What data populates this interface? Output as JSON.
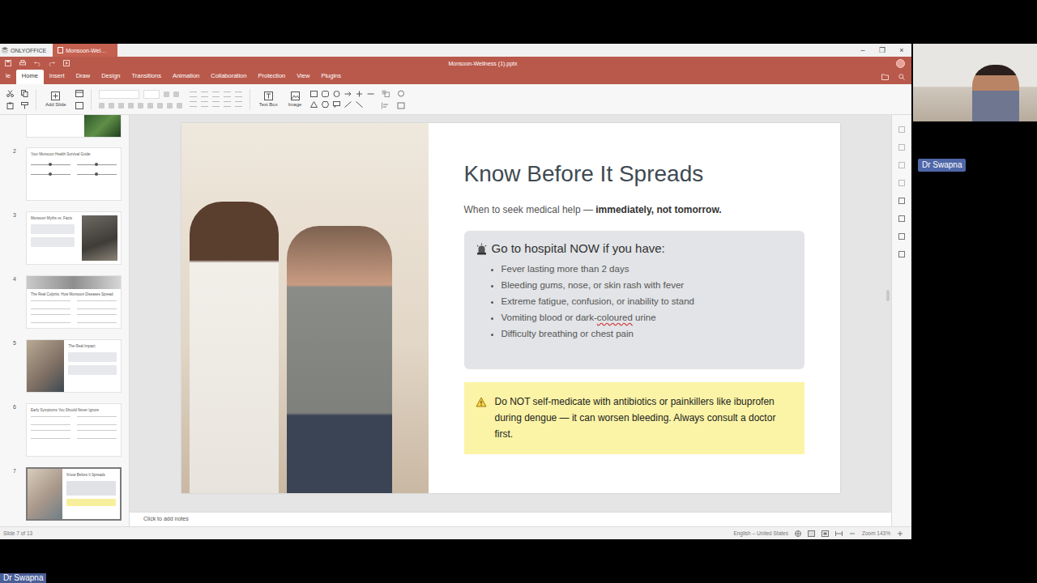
{
  "app_bar": {
    "tabs": [
      {
        "label": "ONLYOFFICE",
        "selected": false
      },
      {
        "label": "Monsoon-Wel…",
        "selected": true
      }
    ],
    "controls": [
      "–",
      "❐",
      "×"
    ]
  },
  "window": {
    "title": "Monsoon-Wellness (1).pptx"
  },
  "menu_tabs": [
    {
      "label": "le",
      "selected": false
    },
    {
      "label": "Home",
      "selected": true
    },
    {
      "label": "Insert",
      "selected": false
    },
    {
      "label": "Draw",
      "selected": false
    },
    {
      "label": "Design",
      "selected": false
    },
    {
      "label": "Transitions",
      "selected": false
    },
    {
      "label": "Animation",
      "selected": false
    },
    {
      "label": "Collaboration",
      "selected": false
    },
    {
      "label": "Protection",
      "selected": false
    },
    {
      "label": "View",
      "selected": false
    },
    {
      "label": "Plugins",
      "selected": false
    }
  ],
  "toolbar": {
    "add_slide": "Add Slide",
    "text_box": "Text Box",
    "image": "Image"
  },
  "slides": [
    {
      "number": "2",
      "title": "Your Monsoon Health Survival Guide",
      "kind": "sliders",
      "selected": false
    },
    {
      "number": "3",
      "title": "Monsoon Myths vs. Facts",
      "kind": "image-right",
      "selected": false
    },
    {
      "number": "4",
      "title": "The Real Culprits: How Monsoon Diseases Spread",
      "kind": "banner",
      "selected": false
    },
    {
      "number": "5",
      "title": "The Real Impact",
      "kind": "image-left",
      "selected": false
    },
    {
      "number": "6",
      "title": "Early Symptoms You Should Never Ignore",
      "kind": "columns",
      "selected": false
    },
    {
      "number": "7",
      "title": "Know Before It Spreads",
      "kind": "image-left",
      "selected": true
    }
  ],
  "slide": {
    "title": "Know Before It Spreads",
    "subtitle": "When to seek medical help — ",
    "subtitle_emphasis": "immediately, not tomorrow.",
    "alert": {
      "heading": "Go to hospital NOW if you have:",
      "items": [
        {
          "text": "Fever lasting more than 2 days",
          "flagged": ""
        },
        {
          "text": "Bleeding gums, nose, or skin rash with fever",
          "flagged": ""
        },
        {
          "text": "Extreme fatigue, confusion, or inability to stand",
          "flagged": ""
        },
        {
          "text": "Vomiting blood or dark-coloured urine",
          "flagged": "coloured"
        },
        {
          "text": "Difficulty breathing or chest pain",
          "flagged": ""
        }
      ]
    },
    "warning": "Do NOT self-medicate with antibiotics or painkillers like ibuprofen during dengue — it can worsen bleeding. Always consult a doctor first."
  },
  "notes": {
    "placeholder": "Click to add notes"
  },
  "status_bar": {
    "slide": "Slide 7 of 13",
    "language": "English – United States",
    "zoom": "Zoom 143%"
  },
  "participant": {
    "name": "Dr Swapna"
  },
  "speaker_label": {
    "name": "Dr Swapna"
  }
}
